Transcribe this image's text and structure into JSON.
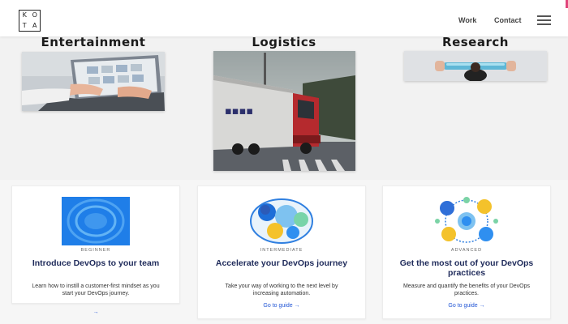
{
  "header": {
    "logo_letters": [
      "K",
      "O",
      "T",
      "A"
    ],
    "nav": {
      "work": "Work",
      "contact": "Contact"
    },
    "menu_icon": "hamburger-menu-icon",
    "accent_color": "#e0457b"
  },
  "categories": [
    {
      "title": "Entertainment",
      "image": "hands-on-laptop-photo"
    },
    {
      "title": "Logistics",
      "image": "truck-photo"
    },
    {
      "title": "Research",
      "image": "person-holding-tube-photo"
    }
  ],
  "cards": [
    {
      "level": "BEGINNER",
      "title": "Introduce DevOps to your team",
      "desc": "Learn how to instill a customer-first mindset as you start your DevOps journey.",
      "link": "→",
      "illustration": "blue-ripple-illustration"
    },
    {
      "level": "INTERMEDIATE",
      "title": "Accelerate your DevOps journey",
      "desc": "Take your way of working to the next level by increasing automation.",
      "link": "Go to guide →",
      "illustration": "team-circles-illustration"
    },
    {
      "level": "ADVANCED",
      "title": "Get the most out of your DevOps practices",
      "desc": "Measure and quantify the benefits of your DevOps practices.",
      "link": "Go to guide →",
      "illustration": "network-circles-illustration"
    }
  ],
  "colors": {
    "card_title": "#1e2a5a",
    "link": "#2155d5"
  }
}
